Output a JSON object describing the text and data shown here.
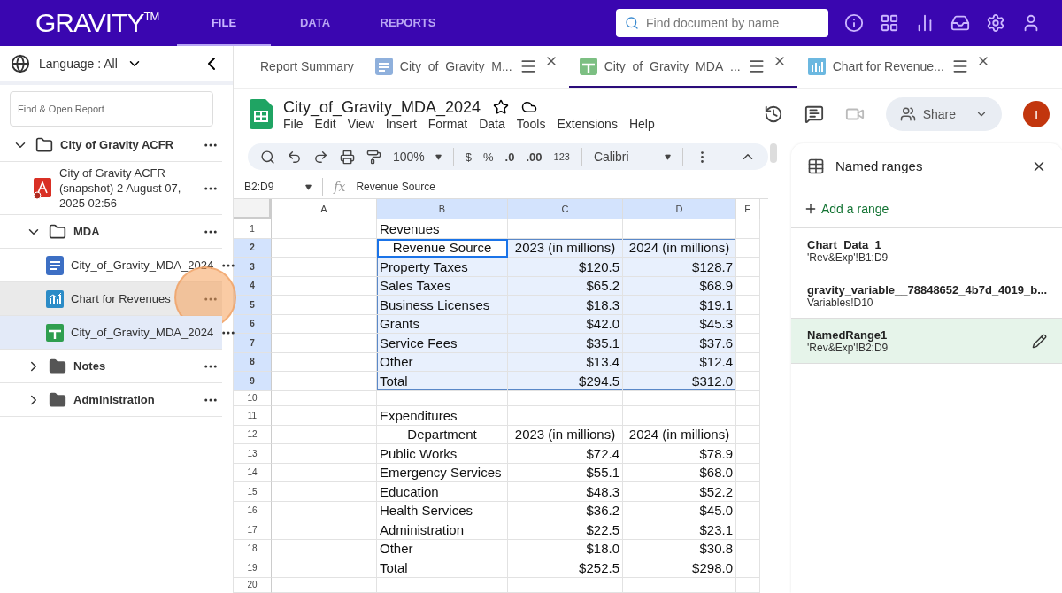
{
  "header": {
    "logo": "GRAVITY",
    "logo_mark": "TM",
    "nav": [
      {
        "label": "FILE",
        "selected": true
      },
      {
        "label": "DATA",
        "selected": false
      },
      {
        "label": "REPORTS",
        "selected": false
      }
    ],
    "search": {
      "placeholder": "Find document by name"
    }
  },
  "sidebar": {
    "language": "Language : All",
    "search": {
      "placeholder": "Find & Open Report"
    },
    "tree": [
      {
        "kind": "folder",
        "label": "City of Gravity ACFR",
        "expanded": true,
        "selected": false,
        "hovered": false,
        "children": [
          {
            "kind": "pdf",
            "label": "City of Gravity ACFR (snapshot) 2 August 07, 2025 02:56",
            "selected": false,
            "hovered": false
          },
          {
            "kind": "folder",
            "label": "MDA",
            "expanded": true,
            "selected": false,
            "hovered": false,
            "children": [
              {
                "kind": "doc",
                "label": "City_of_Gravity_MDA_2024",
                "selected": false,
                "hovered": false
              },
              {
                "kind": "chart",
                "label": "Chart for Revenues",
                "selected": false,
                "hovered": true
              },
              {
                "kind": "sheet",
                "label": "City_of_Gravity_MDA_2024",
                "selected": true,
                "hovered": false
              }
            ]
          },
          {
            "kind": "folder",
            "label": "Notes",
            "expanded": false,
            "selected": false,
            "hovered": false
          },
          {
            "kind": "folder",
            "label": "Administration",
            "expanded": false,
            "selected": false,
            "hovered": false
          }
        ]
      }
    ]
  },
  "tabs": [
    {
      "kind": "summary",
      "label": "Report Summary",
      "selected": false
    },
    {
      "kind": "doc",
      "label": "City_of_Gravity_M...",
      "selected": false
    },
    {
      "kind": "sheet",
      "label": "City_of_Gravity_MDA_...",
      "selected": true
    },
    {
      "kind": "chart",
      "label": "Chart for Revenue...",
      "selected": false
    }
  ],
  "document": {
    "title": "City_of_Gravity_MDA_2024",
    "menu": [
      "File",
      "Edit",
      "View",
      "Insert",
      "Format",
      "Data",
      "Tools",
      "Extensions",
      "Help"
    ],
    "share": "Share",
    "avatar": "I",
    "toolbar": {
      "zoom": "100%",
      "currency": "$",
      "percent": "%",
      "decrease_decimal": ".0",
      "increase_decimal": ".00",
      "number_format": "123",
      "font": "Calibri"
    },
    "formula_bar": {
      "cell": "B2:D9",
      "fx": "fx",
      "value": "Revenue Source"
    }
  },
  "grid": {
    "columns": [
      {
        "label": "A",
        "selected": false
      },
      {
        "label": "B",
        "selected": true
      },
      {
        "label": "C",
        "selected": true
      },
      {
        "label": "D",
        "selected": true
      },
      {
        "label": "E",
        "selected": false
      }
    ],
    "rows": [
      {
        "num": "1",
        "kind": "title",
        "selected": false,
        "cells": [
          "",
          "Revenues",
          "",
          ""
        ]
      },
      {
        "num": "2",
        "kind": "header",
        "selected": true,
        "active": true,
        "cells": [
          "",
          "Revenue Source",
          "2023 (in millions)",
          "2024 (in millions)"
        ]
      },
      {
        "num": "3",
        "kind": "data",
        "selected": true,
        "cells": [
          "",
          "Property Taxes",
          "$120.5",
          "$128.7"
        ]
      },
      {
        "num": "4",
        "kind": "data",
        "selected": true,
        "cells": [
          "",
          "Sales Taxes",
          "$65.2",
          "$68.9"
        ]
      },
      {
        "num": "5",
        "kind": "data",
        "selected": true,
        "cells": [
          "",
          "Business Licenses",
          "$18.3",
          "$19.1"
        ]
      },
      {
        "num": "6",
        "kind": "data",
        "selected": true,
        "cells": [
          "",
          "Grants",
          "$42.0",
          "$45.3"
        ]
      },
      {
        "num": "7",
        "kind": "data",
        "selected": true,
        "cells": [
          "",
          "Service Fees",
          "$35.1",
          "$37.6"
        ]
      },
      {
        "num": "8",
        "kind": "data",
        "selected": true,
        "cells": [
          "",
          "Other",
          "$13.4",
          "$12.4"
        ]
      },
      {
        "num": "9",
        "kind": "data",
        "selected": true,
        "cells": [
          "",
          "Total",
          "$294.5",
          "$312.0"
        ]
      },
      {
        "num": "10",
        "kind": "blank",
        "selected": false,
        "cells": [
          "",
          "",
          "",
          ""
        ]
      },
      {
        "num": "11",
        "kind": "title",
        "selected": false,
        "cells": [
          "",
          "Expenditures",
          "",
          ""
        ]
      },
      {
        "num": "12",
        "kind": "header",
        "selected": false,
        "cells": [
          "",
          "Department",
          "2023 (in millions)",
          "2024 (in millions)"
        ]
      },
      {
        "num": "13",
        "kind": "data",
        "selected": false,
        "cells": [
          "",
          "Public Works",
          "$72.4",
          "$78.9"
        ]
      },
      {
        "num": "14",
        "kind": "data",
        "selected": false,
        "cells": [
          "",
          "Emergency Services",
          "$55.1",
          "$68.0"
        ]
      },
      {
        "num": "15",
        "kind": "data",
        "selected": false,
        "cells": [
          "",
          "Education",
          "$48.3",
          "$52.2"
        ]
      },
      {
        "num": "16",
        "kind": "data",
        "selected": false,
        "cells": [
          "",
          "Health Services",
          "$36.2",
          "$45.0"
        ]
      },
      {
        "num": "17",
        "kind": "data",
        "selected": false,
        "cells": [
          "",
          "Administration",
          "$22.5",
          "$23.1"
        ]
      },
      {
        "num": "18",
        "kind": "data",
        "selected": false,
        "cells": [
          "",
          "Other",
          "$18.0",
          "$30.8"
        ]
      },
      {
        "num": "19",
        "kind": "data",
        "selected": false,
        "cells": [
          "",
          "Total",
          "$252.5",
          "$298.0"
        ]
      },
      {
        "num": "20",
        "kind": "blank",
        "selected": false,
        "cells": [
          "",
          "",
          "",
          ""
        ]
      }
    ]
  },
  "named_ranges": {
    "title": "Named ranges",
    "add": "Add a range",
    "items": [
      {
        "name": "Chart_Data_1",
        "range": "'Rev&Exp'!B1:D9",
        "selected": false
      },
      {
        "name": "gravity_variable__78848652_4b7d_4019_b...",
        "range": "Variables!D10",
        "selected": false
      },
      {
        "name": "NamedRange1",
        "range": "'Rev&Exp'!B2:D9",
        "selected": true
      }
    ]
  }
}
